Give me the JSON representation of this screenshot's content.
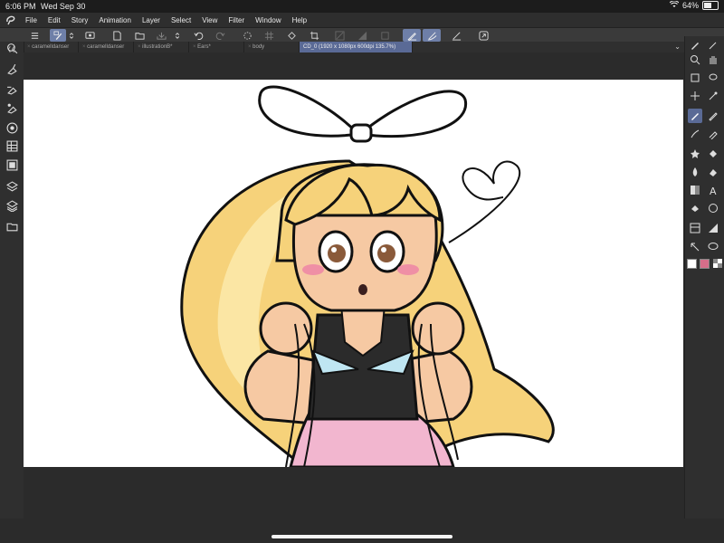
{
  "status": {
    "time": "6:06 PM",
    "date": "Wed Sep 30",
    "battery": "64%",
    "battery_level": 0.64
  },
  "menu": [
    "File",
    "Edit",
    "Story",
    "Animation",
    "Layer",
    "Select",
    "View",
    "Filter",
    "Window",
    "Help"
  ],
  "tabs": [
    {
      "label": "caramelldanser",
      "active": false
    },
    {
      "label": "caramelldanser",
      "active": false
    },
    {
      "label": "illustrationB*",
      "active": false
    },
    {
      "label": "Ears*",
      "active": false
    },
    {
      "label": "body",
      "active": false
    },
    {
      "label": "CD_0 (1920 x 1080px 600dpi 135.7%)",
      "active": true
    }
  ],
  "toolbar_icons": [
    "menu-icon",
    "brush-select-icon",
    "stepper-icon",
    "screen-icon",
    "new-icon",
    "open-icon",
    "save-icon",
    "stepper2-icon",
    "undo-icon",
    "redo-icon",
    "lasso-icon",
    "grid-icon",
    "fill-icon",
    "crop-icon",
    "transform-icon",
    "ruler-icon",
    "layer-icon",
    "pen-icon",
    "pen2-icon",
    "pen3-icon",
    "share-icon"
  ],
  "colors": {
    "accent": "#5a6a96",
    "toolbar": "#3a3a3a",
    "canvas": "#ffffff",
    "bg": "#2b2b2b",
    "main_color": "#ffffff",
    "sub_color": "#d66e8a"
  }
}
